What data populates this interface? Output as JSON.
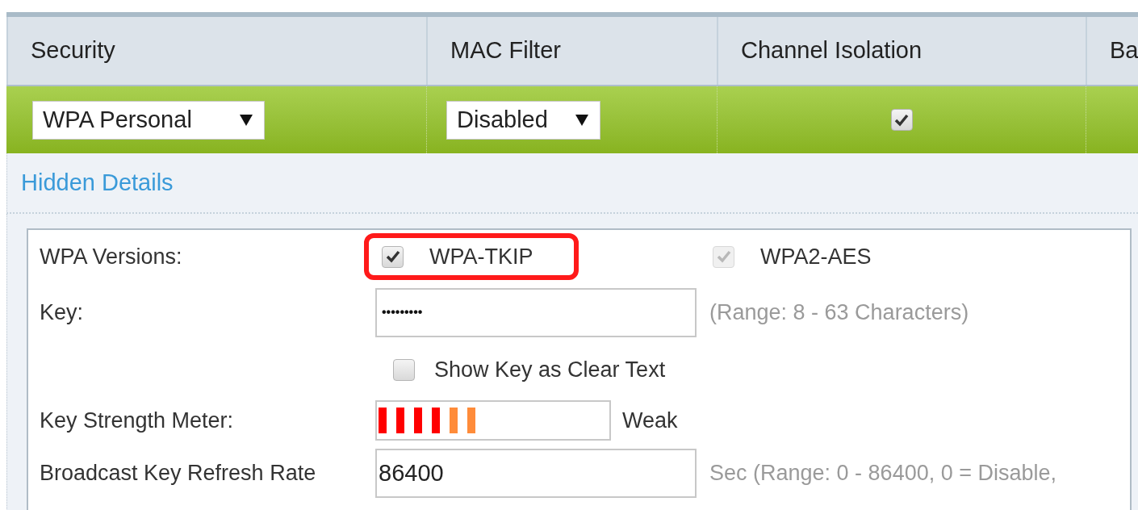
{
  "table": {
    "columns": [
      "Security",
      "MAC Filter",
      "Channel Isolation",
      "Ba"
    ],
    "row": {
      "security": {
        "value": "WPA Personal"
      },
      "mac_filter": {
        "value": "Disabled"
      },
      "channel_isolation": {
        "checked": true
      }
    }
  },
  "details_link": "Hidden Details",
  "details": {
    "wpa_versions": {
      "label": "WPA Versions:",
      "options": [
        {
          "label": "WPA-TKIP",
          "checked": true,
          "disabled": false,
          "highlighted": true
        },
        {
          "label": "WPA2-AES",
          "checked": true,
          "disabled": true,
          "highlighted": false
        }
      ]
    },
    "key": {
      "label": "Key:",
      "value": "•••••••••",
      "hint": "(Range: 8 - 63 Characters)"
    },
    "show_key": {
      "label": "Show Key as Clear Text",
      "checked": false
    },
    "strength": {
      "label": "Key Strength Meter:",
      "reading": "Weak",
      "bars": [
        {
          "color": "#ff0000"
        },
        {
          "color": "#ff0000"
        },
        {
          "color": "#ff0000"
        },
        {
          "color": "#ff0000"
        },
        {
          "color": "#ff8c3a"
        },
        {
          "color": "#ff8c3a"
        }
      ]
    },
    "refresh": {
      "label": "Broadcast Key Refresh Rate",
      "value": "86400",
      "hint": "Sec (Range: 0 - 86400, 0 = Disable,"
    }
  }
}
